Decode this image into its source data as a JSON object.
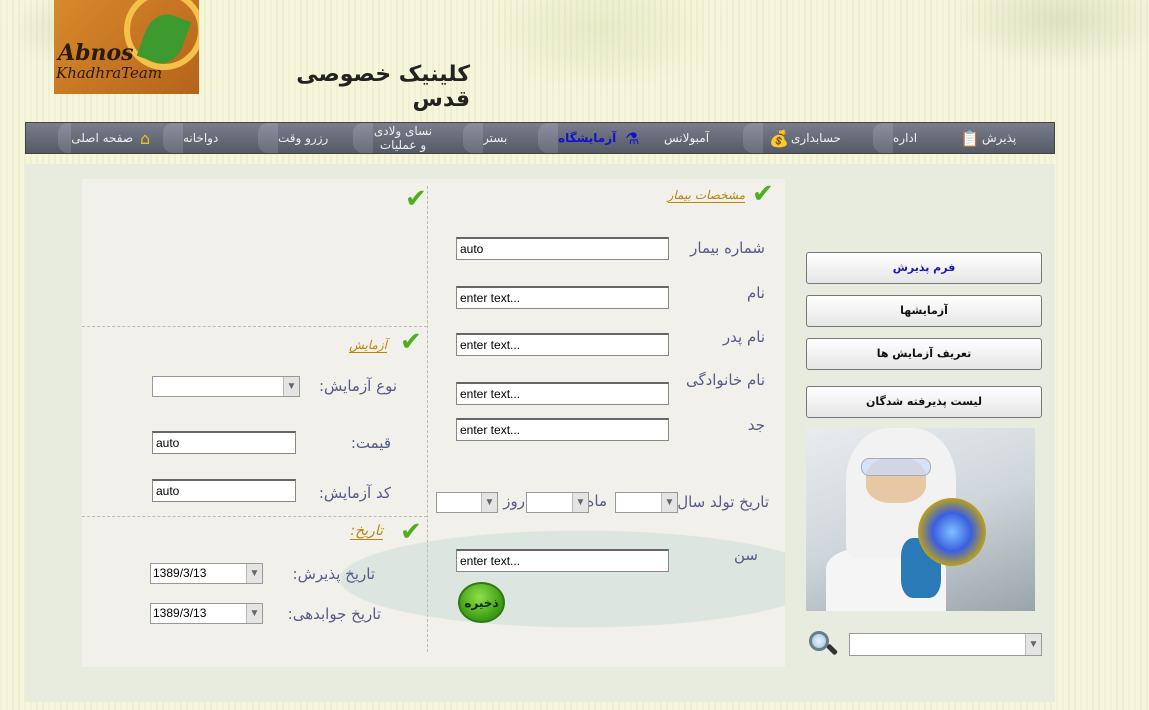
{
  "header": {
    "logo_line1": "Abnos",
    "logo_line2": "KhadhraTeam",
    "clinic_title": "کلینیک خصوصی قدس"
  },
  "nav": {
    "items": [
      {
        "label": "پذیرش",
        "icon": "clipboard-icon"
      },
      {
        "label": "اداره",
        "icon": ""
      },
      {
        "label": "حسابداری",
        "icon": "coins-icon"
      },
      {
        "label": "آمبولانس",
        "icon": ""
      },
      {
        "label": "آزمایشگاه",
        "icon": "flask-icon",
        "active": true
      },
      {
        "label": "بستر",
        "icon": ""
      },
      {
        "label": "نسای ولادی و عملیات",
        "icon": ""
      },
      {
        "label": "رزرو وقت",
        "icon": ""
      },
      {
        "label": "دواخانه",
        "icon": ""
      },
      {
        "label": "صفحه اصلی",
        "icon": "home-icon"
      }
    ]
  },
  "patient": {
    "section_title": "مشخصات بیمار",
    "patient_number_label": "شماره بیمار",
    "patient_number_value": "auto",
    "name_label": "نام",
    "father_name_label": "نام پدر",
    "family_name_label": "نام خانوادگی",
    "grandfather_label": "جد",
    "placeholder": "enter text...",
    "birth_year_label": "تاریخ تولد سال",
    "month_label": "ماه",
    "day_label": "روز",
    "age_label": "سن",
    "save_label": "ذخیره"
  },
  "test": {
    "section_title": "آزمایش",
    "test_type_label": "نوع آزمایش:",
    "price_label": "قیمت:",
    "price_value": "auto",
    "code_label": "کد آزمایش:",
    "code_value": "auto"
  },
  "dates": {
    "section_title": "تاریخ:",
    "admission_label": "تاریخ پذیرش:",
    "admission_value": "1389/3/13",
    "answer_label": "تاریخ جوابدهی:",
    "answer_value": "1389/3/13"
  },
  "sidebar": {
    "btn_admission_form": "فرم پذیرش",
    "btn_tests": "آزمایشها",
    "btn_define_tests": "تعریف آزمایش ها",
    "btn_admitted_list": "لیست پذیرفته شدگان"
  },
  "colors": {
    "nav_bg": "#5f6371",
    "accent_check": "#4caf1c",
    "label_color": "#555a88",
    "active_nav": "#1010d0"
  }
}
